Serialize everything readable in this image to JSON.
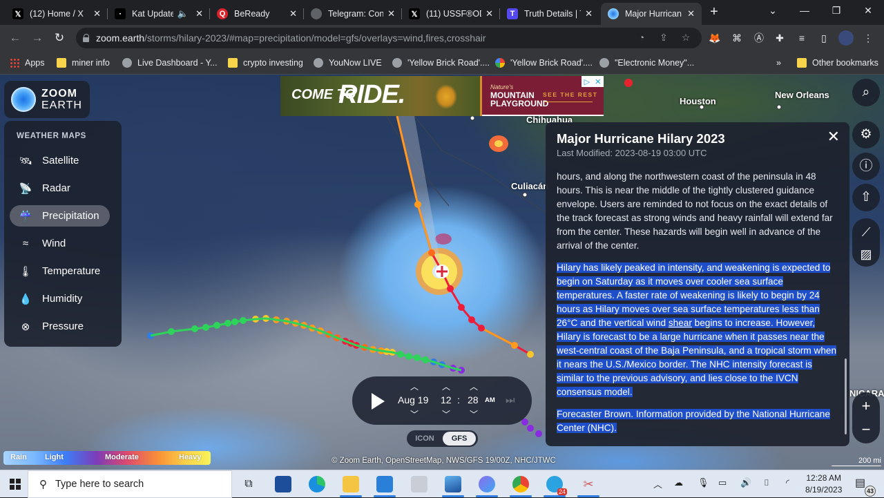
{
  "browser": {
    "tabs": [
      {
        "title": "(12) Home / X",
        "icon": "x-logo-icon",
        "active": false
      },
      {
        "title": "Kat Update",
        "icon": "video-icon",
        "active": false,
        "audio": true
      },
      {
        "title": "BeReady",
        "icon": "beready-icon",
        "active": false
      },
      {
        "title": "Telegram: Cont",
        "icon": "globe-icon",
        "active": false
      },
      {
        "title": "(11) USSF®OD",
        "icon": "x-logo-icon",
        "active": false
      },
      {
        "title": "Truth Details | T",
        "icon": "truth-social-icon",
        "active": false
      },
      {
        "title": "Major Hurrican",
        "icon": "zoom-earth-icon",
        "active": true
      }
    ],
    "new_tab_label": "+",
    "url_host": "zoom.earth",
    "url_path": "/storms/hilary-2023/#map=precipitation/model=gfs/overlays=wind,fires,crosshair",
    "bookmarks": [
      {
        "label": "Apps",
        "icon": "apps"
      },
      {
        "label": "miner info",
        "icon": "folder"
      },
      {
        "label": "Live Dashboard - Y...",
        "icon": "globe"
      },
      {
        "label": "crypto investing",
        "icon": "folder"
      },
      {
        "label": "YouNow LIVE",
        "icon": "globe"
      },
      {
        "label": "'Yellow Brick Road'....",
        "icon": "globe"
      },
      {
        "label": "'Yellow Brick Road'....",
        "icon": "google"
      },
      {
        "label": "\"Electronic Money\"...",
        "icon": "globe"
      }
    ],
    "bookmarks_overflow": "»",
    "other_bookmarks": "Other bookmarks"
  },
  "app": {
    "logo_line1": "ZOOM",
    "logo_line2": "EARTH",
    "weather_maps_heading": "WEATHER MAPS",
    "weather_maps": [
      {
        "label": "Satellite",
        "icon": "satellite-icon",
        "glyph": "🛰",
        "active": false
      },
      {
        "label": "Radar",
        "icon": "radar-dish-icon",
        "glyph": "📡",
        "active": false
      },
      {
        "label": "Precipitation",
        "icon": "rain-cloud-icon",
        "glyph": "☔",
        "active": true
      },
      {
        "label": "Wind",
        "icon": "wind-icon",
        "glyph": "≈",
        "active": false
      },
      {
        "label": "Temperature",
        "icon": "thermometer-icon",
        "glyph": "🌡",
        "active": false
      },
      {
        "label": "Humidity",
        "icon": "humidity-icon",
        "glyph": "💧",
        "active": false
      },
      {
        "label": "Pressure",
        "icon": "compass-gauge-icon",
        "glyph": "⊗",
        "active": false
      }
    ],
    "map_labels": {
      "houston": "Houston",
      "new_orleans": "New Orleans",
      "chihuahua": "Chihuahua",
      "culiacan": "Culiacán",
      "nicaragua": "NICARA"
    },
    "ad": {
      "headline_small": "COME TO",
      "headline_big": "RIDE.",
      "brand_tag": "Nature's",
      "brand_line1": "MOUNTAIN",
      "brand_line2": "PLAYGROUND",
      "cta": "SEE THE REST"
    },
    "storm_panel": {
      "title": "Major Hurricane Hilary 2023",
      "last_modified": "Last Modified: 2023-08-19 03:00 UTC",
      "paragraph1": "hours, and along the northwestern coast of the peninsula in 48 hours. This is near the middle of the tightly clustered guidance envelope. Users are reminded to not focus on the exact details of the track forecast as strong winds and heavy rainfall will extend far from the center. These hazards will begin well in advance of the arrival of the center.",
      "paragraph2_before": "Hilary has likely peaked in intensity, and weakening is expected to begin on Saturday as it moves over cooler sea surface temperatures. A faster rate of weakening is likely to begin by 24 hours as Hilary moves over sea surface temperatures less than 26°C and the vertical wind ",
      "paragraph2_link": "shear",
      "paragraph2_after": " begins to increase. However, Hilary is forecast to be a large hurricane when it passes near the west-central coast of the Baja Peninsula, and a tropical storm when it nears the U.S./Mexico border. The NHC intensity forecast is similar to the previous advisory, and lies close to the IVCN consensus model.",
      "paragraph3": "Forecaster Brown. Information provided by the National Hurricane Center (NHC).",
      "close_label": "✕"
    },
    "time_control": {
      "date": "Aug 19",
      "hour": "12",
      "separator": ":",
      "minute": "28",
      "ampm": "AM"
    },
    "models": [
      {
        "label": "ICON",
        "active": false
      },
      {
        "label": "GFS",
        "active": true
      }
    ],
    "legend": {
      "rain": "Rain",
      "light": "Light",
      "moderate": "Moderate",
      "heavy": "Heavy"
    },
    "attribution": "© Zoom Earth, OpenStreetMap, NWS/GFS 19/00Z, NHC/JTWC",
    "scale_label": "200 mi",
    "track_colors": {
      "depression": "#2f7de8",
      "storm": "#2ed35a",
      "cat1": "#f9c72a",
      "cat2": "#ff9a1f",
      "cat3": "#ff6a1a",
      "cat4": "#ef1d3a",
      "extratropical": "#8a2be2"
    }
  },
  "taskbar": {
    "search_placeholder": "Type here to search",
    "time": "12:28 AM",
    "date": "8/19/2023",
    "telegram_badge": "24",
    "notification_count": "43"
  }
}
